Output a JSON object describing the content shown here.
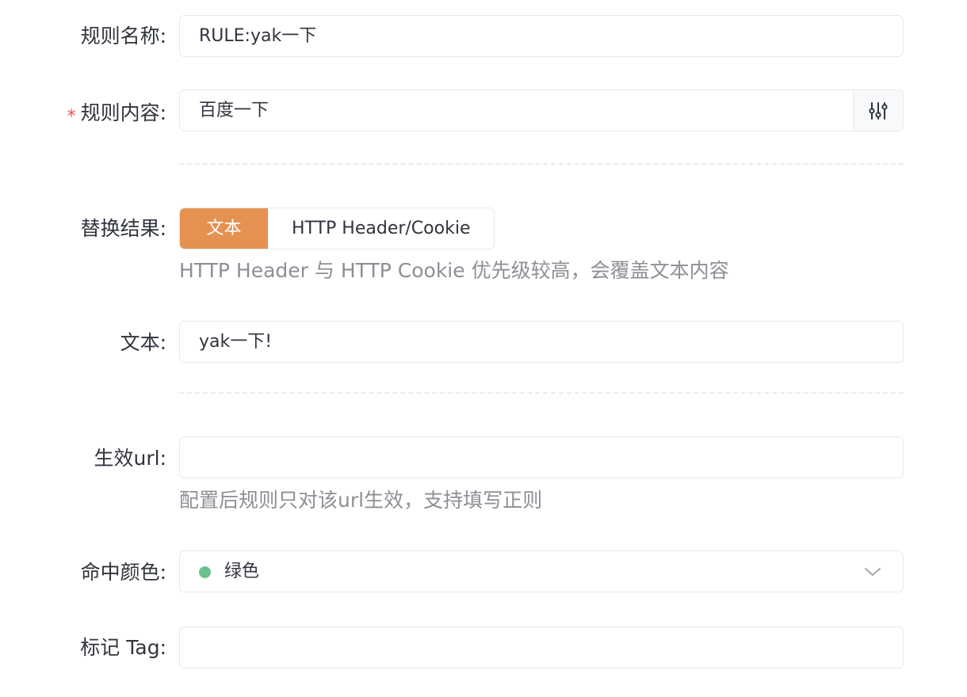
{
  "form": {
    "rule_name": {
      "label": "规则名称:",
      "value": "RULE:yak一下"
    },
    "rule_content": {
      "label": "规则内容:",
      "required_mark": "*",
      "value": "百度一下",
      "addon_icon": "sliders-icon"
    },
    "replace_result": {
      "label": "替换结果:",
      "options": [
        "文本",
        "HTTP Header/Cookie"
      ],
      "selected": "文本",
      "help": "HTTP Header 与 HTTP Cookie 优先级较高，会覆盖文本内容"
    },
    "text": {
      "label": "文本:",
      "value": "yak一下!"
    },
    "effective_url": {
      "label": "生效url:",
      "value": "",
      "help": "配置后规则只对该url生效，支持填写正则"
    },
    "hit_color": {
      "label": "命中颜色:",
      "value": "绿色",
      "color": "#6ac28d",
      "icon": "chevron-down-icon"
    },
    "tag": {
      "label": "标记 Tag:",
      "value": ""
    }
  },
  "colors": {
    "accent": "#e59151",
    "required": "#f04b51",
    "border": "#e6e8ed",
    "help_text": "#8d8f96"
  }
}
